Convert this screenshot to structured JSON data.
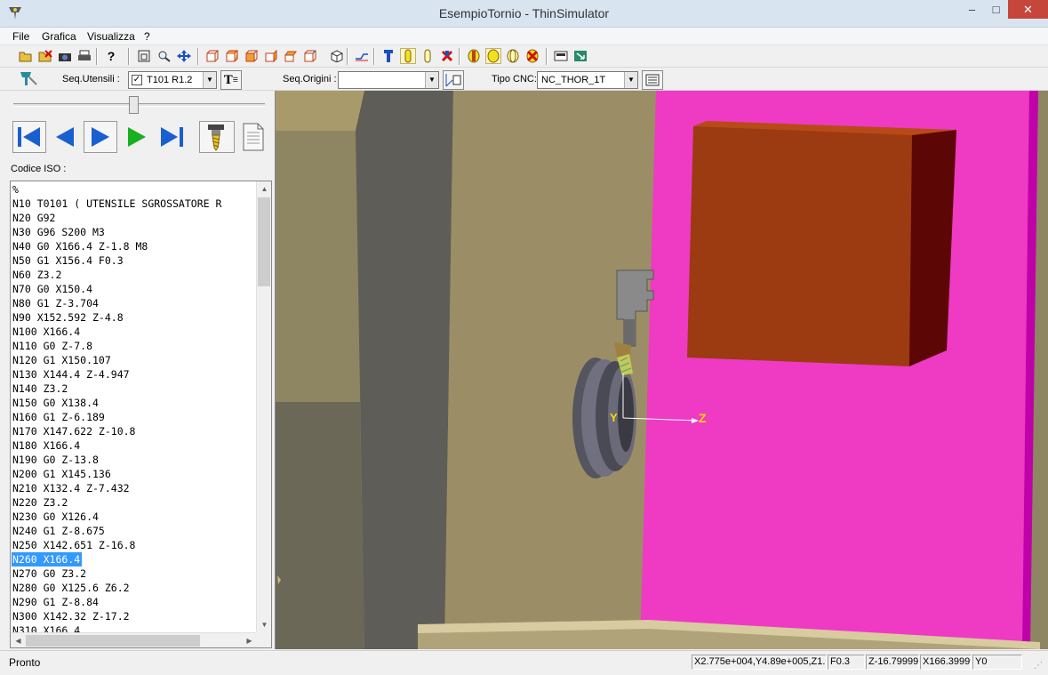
{
  "window": {
    "title": "EsempioTornio - ThinSimulator",
    "minimize": "–",
    "maximize": "□",
    "close": "✕"
  },
  "menu": [
    "File",
    "Grafica",
    "Visualizza",
    "?"
  ],
  "toolbar2": {
    "seq_utensili_label": "Seq.Utensili :",
    "tool_value": "T101 R1.2",
    "tool_checked": "✓",
    "seq_origini_label": "Seq.Origini :",
    "origini_value": "",
    "tipo_cnc_label": "Tipo CNC:",
    "cnc_value": "NC_THOR_1T",
    "btn_text": "T"
  },
  "left": {
    "codice_label": "Codice ISO :",
    "code_lines": [
      "%",
      "N10 T0101 ( UTENSILE SGROSSATORE R",
      "N20 G92",
      "N30 G96 S200 M3",
      "N40 G0 X166.4 Z-1.8 M8",
      "N50 G1 X156.4 F0.3",
      "N60 Z3.2",
      "N70 G0 X150.4",
      "N80 G1 Z-3.704",
      "N90 X152.592 Z-4.8",
      "N100 X166.4",
      "N110 G0 Z-7.8",
      "N120 G1 X150.107",
      "N130 X144.4 Z-4.947",
      "N140 Z3.2",
      "N150 G0 X138.4",
      "N160 G1 Z-6.189",
      "N170 X147.622 Z-10.8",
      "N180 X166.4",
      "N190 G0 Z-13.8",
      "N200 G1 X145.136",
      "N210 X132.4 Z-7.432",
      "N220 Z3.2",
      "N230 G0 X126.4",
      "N240 G1 Z-8.675",
      "N250 X142.651 Z-16.8",
      "N260 X166.4",
      "N270 G0 Z3.2",
      "N280 G0 X125.6 Z6.2",
      "N290 G1 Z-8.84",
      "N300 X142.32 Z-17.2",
      "N310 X166.4"
    ],
    "selected_index": 26,
    "slider_position": 0.48
  },
  "view3d": {
    "axis_y": "Y",
    "axis_z": "Z"
  },
  "status": {
    "text": "Pronto",
    "coords": "X2.775e+004,Y4.89e+005,Z1.",
    "feed": "F0.3",
    "z": "Z-16.79999",
    "x": "X166.39999",
    "y": "Y0"
  },
  "colors": {
    "magenta": "#ef3ac4",
    "block_front": "#9c3a12",
    "block_side": "#5c0606",
    "floor": "#9b8e66",
    "dark_wall": "#5d5c56",
    "axis_label": "#ffd800"
  }
}
